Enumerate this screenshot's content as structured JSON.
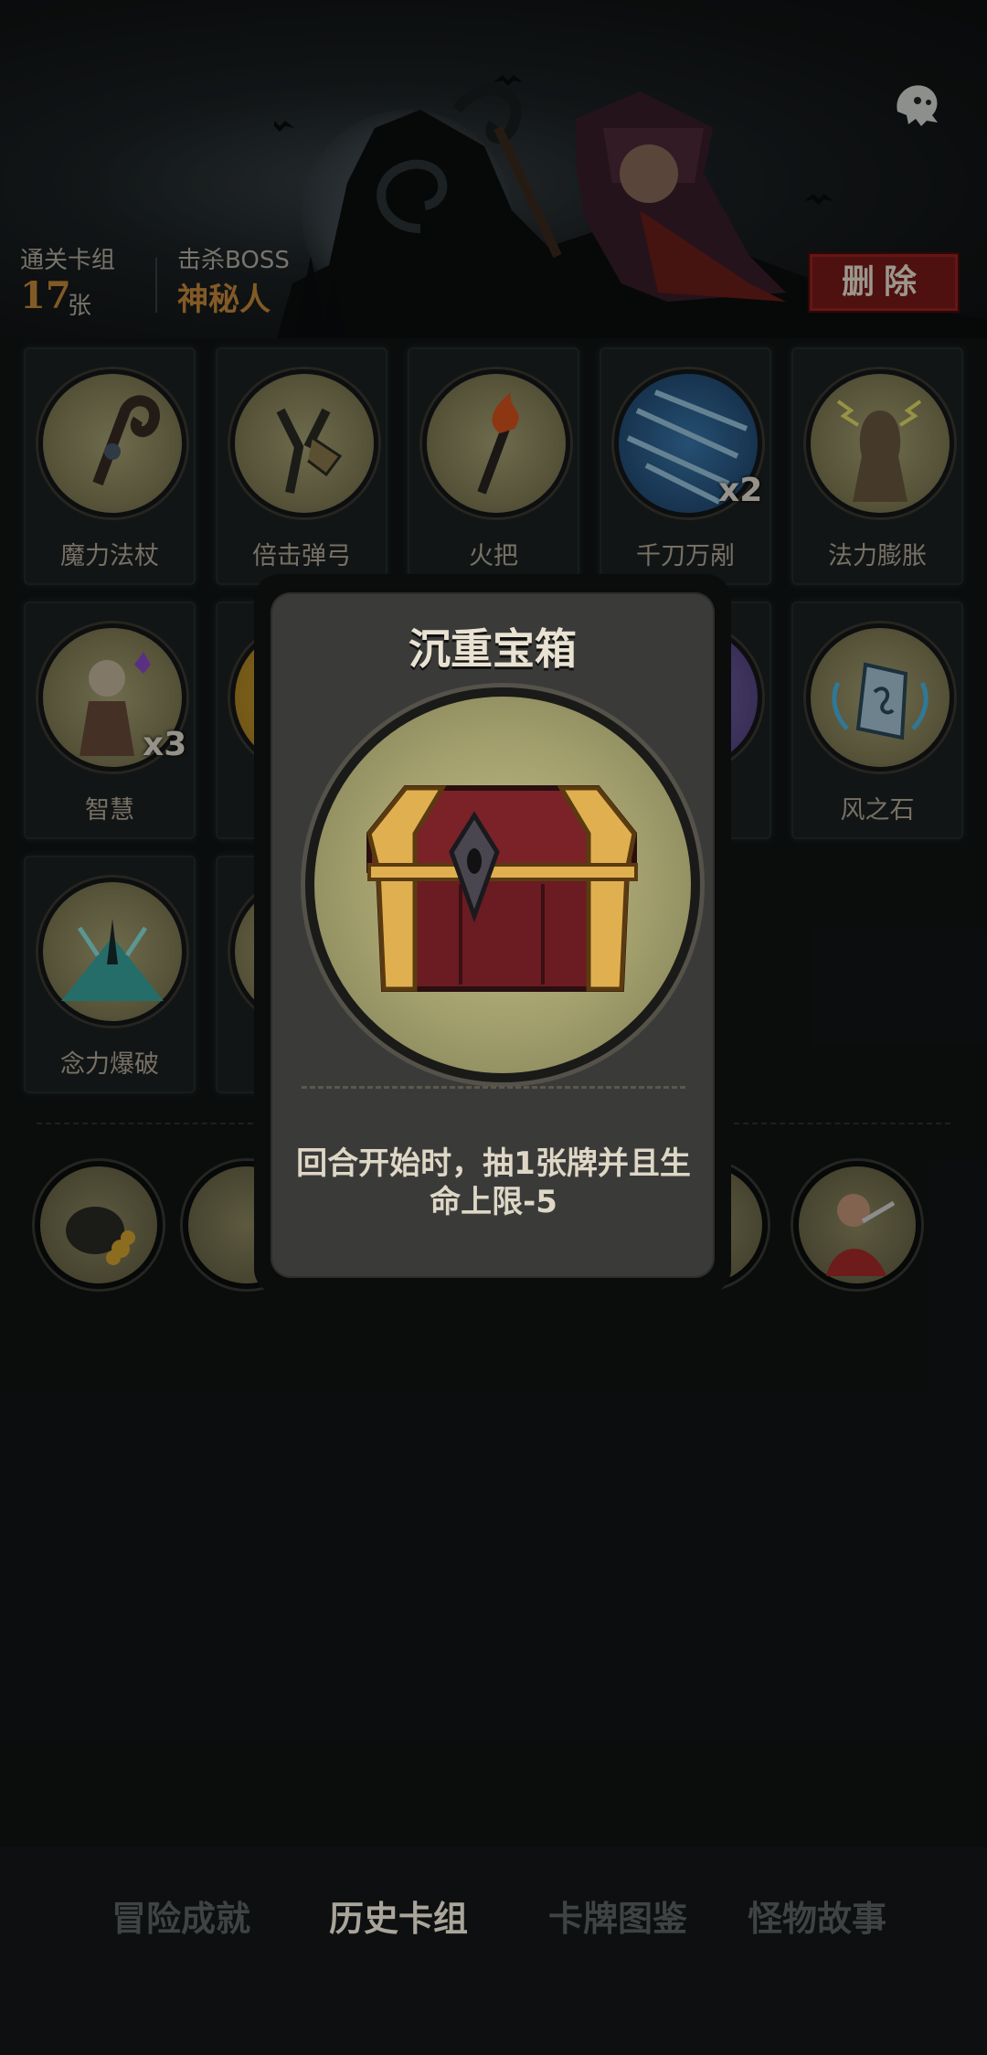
{
  "header": {
    "cleared_deck_label": "通关卡组",
    "cleared_deck_count": "17",
    "cleared_deck_unit": "张",
    "boss_label": "击杀BOSS",
    "boss_name": "神秘人",
    "delete_label": "删除"
  },
  "cards": [
    {
      "name": "魔力法杖",
      "badge": ""
    },
    {
      "name": "倍击弹弓",
      "badge": ""
    },
    {
      "name": "火把",
      "badge": ""
    },
    {
      "name": "千刀万剐",
      "badge": "x2"
    },
    {
      "name": "法力膨胀",
      "badge": ""
    },
    {
      "name": "智慧",
      "badge": "x3"
    },
    {
      "name": "风之石",
      "badge": ""
    },
    {
      "name": "念力爆破",
      "badge": ""
    }
  ],
  "popup": {
    "title": "沉重宝箱",
    "description": "回合开始时，抽1张牌并且生命上限-5"
  },
  "bottom_nav": [
    {
      "label": "冒险成就",
      "active": false
    },
    {
      "label": "历史卡组",
      "active": true
    },
    {
      "label": "卡牌图鉴",
      "active": false
    },
    {
      "label": "怪物故事",
      "active": false
    }
  ],
  "colors": {
    "accent": "#c98a3a",
    "delete_red": "#7a1a1a"
  }
}
